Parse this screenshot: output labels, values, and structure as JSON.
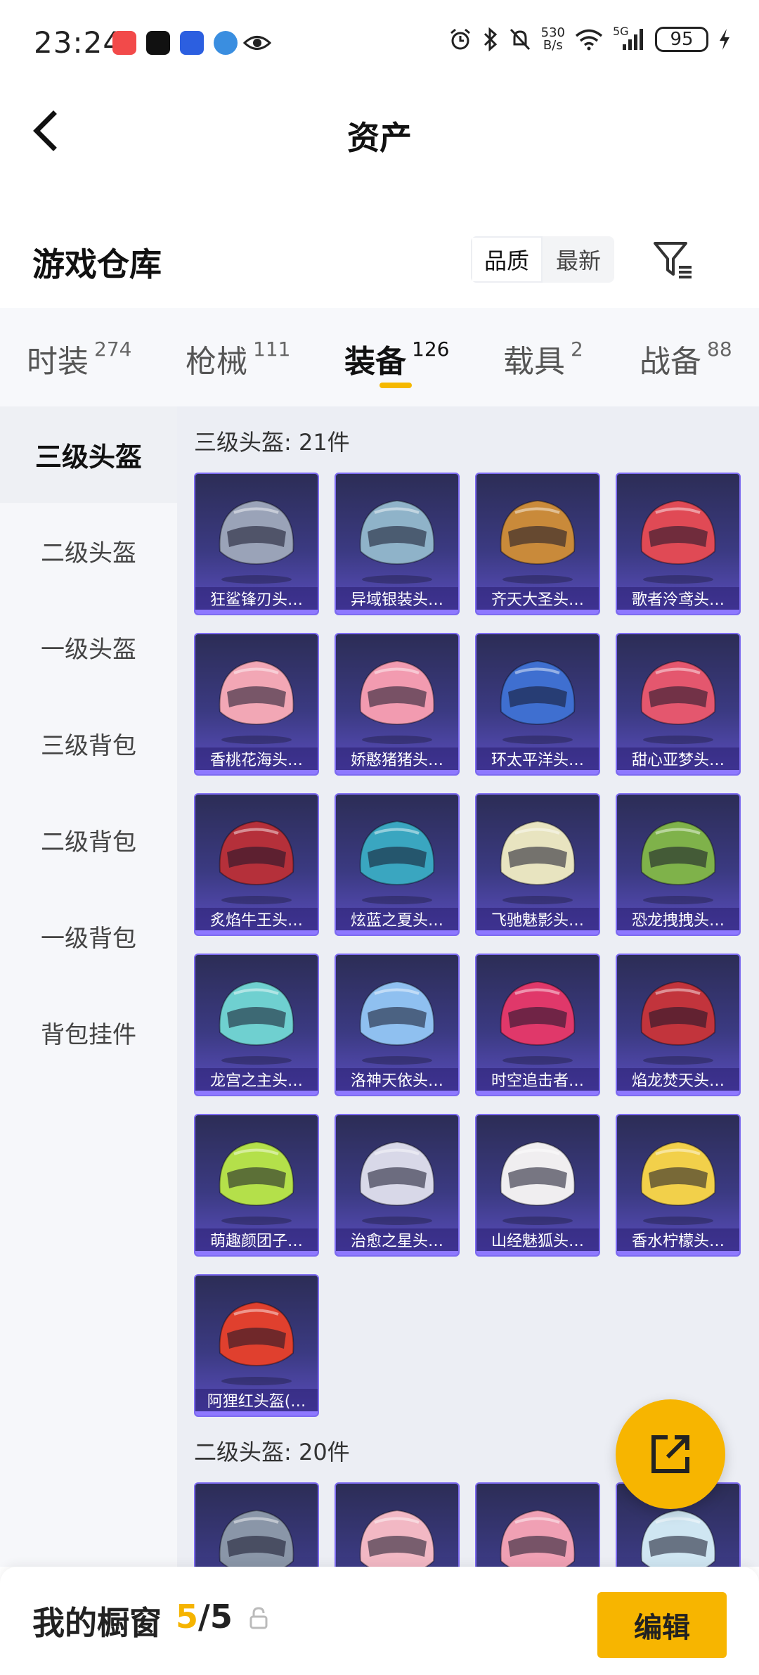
{
  "status_bar": {
    "time": "23:24",
    "net_speed_value": "530",
    "net_speed_unit": "B/s",
    "network": "5G",
    "battery": "95",
    "icons": [
      "alarm-icon",
      "bluetooth-icon",
      "mute-icon",
      "wifi-icon",
      "signal-icon",
      "charging-icon"
    ]
  },
  "nav": {
    "title": "资产"
  },
  "warehouse": {
    "title": "游戏仓库",
    "sort_options": [
      "品质",
      "最新"
    ],
    "sort_selected": "品质"
  },
  "tabs": [
    {
      "label": "时装",
      "count": "274"
    },
    {
      "label": "枪械",
      "count": "111"
    },
    {
      "label": "装备",
      "count": "126",
      "active": true
    },
    {
      "label": "载具",
      "count": "2"
    },
    {
      "label": "战备",
      "count": "88"
    }
  ],
  "sidebar": {
    "items": [
      "三级头盔",
      "二级头盔",
      "一级头盔",
      "三级背包",
      "二级背包",
      "一级背包",
      "背包挂件"
    ],
    "active": "三级头盔"
  },
  "sections": [
    {
      "title": "三级头盔: 21件",
      "items": [
        {
          "name": "狂鲨锋刃头…",
          "color": "#9aa3b8"
        },
        {
          "name": "异域银装头…",
          "color": "#8fb3c9"
        },
        {
          "name": "齐天大圣头…",
          "color": "#c98a3a"
        },
        {
          "name": "歌者泠鸢头…",
          "color": "#e04a55"
        },
        {
          "name": "香桃花海头…",
          "color": "#f2a7b5"
        },
        {
          "name": "娇憨猪猪头…",
          "color": "#f29bb0"
        },
        {
          "name": "环太平洋头…",
          "color": "#3f6fd0"
        },
        {
          "name": "甜心亚梦头…",
          "color": "#e4576e"
        },
        {
          "name": "炙焰牛王头…",
          "color": "#b5303a"
        },
        {
          "name": "炫蓝之夏头…",
          "color": "#3aa6c0"
        },
        {
          "name": "飞驰魅影头…",
          "color": "#e8e4c0"
        },
        {
          "name": "恐龙拽拽头…",
          "color": "#7fb24a"
        },
        {
          "name": "龙宫之主头…",
          "color": "#6fd0d0"
        },
        {
          "name": "洛神天依头…",
          "color": "#8fc0f0"
        },
        {
          "name": "时空追击者…",
          "color": "#e0386a"
        },
        {
          "name": "焰龙焚天头…",
          "color": "#c2343c"
        },
        {
          "name": "萌趣颜团子…",
          "color": "#b4e04a"
        },
        {
          "name": "治愈之星头…",
          "color": "#d8d8e8"
        },
        {
          "name": "山经魅狐头…",
          "color": "#f0eef0"
        },
        {
          "name": "香水柠檬头…",
          "color": "#f2d04a"
        },
        {
          "name": "阿狸红头盔(…",
          "color": "#e0402e"
        }
      ]
    },
    {
      "title": "二级头盔: 20件",
      "items": [
        {
          "name": "",
          "color": "#8a96a8"
        },
        {
          "name": "",
          "color": "#f2b8c4"
        },
        {
          "name": "",
          "color": "#f0a0b4"
        },
        {
          "name": "",
          "color": "#cfe6f2"
        }
      ]
    }
  ],
  "fab": {
    "icon": "share-out-icon"
  },
  "bottom_bar": {
    "label": "我的橱窗",
    "current": "5",
    "separator": "/",
    "total": "5",
    "edit_label": "编辑"
  }
}
